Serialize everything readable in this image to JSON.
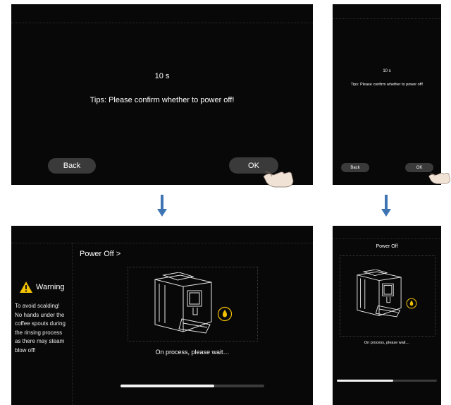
{
  "confirm_dialog": {
    "countdown": "10 s",
    "tip": "Tips: Please confirm whether to power off!",
    "back_label": "Back",
    "ok_label": "OK"
  },
  "power_off_screen": {
    "breadcrumb": "Power Off >",
    "title": "Power Off",
    "warning_title": "Warning",
    "warning_lines": [
      "To avoid scalding!",
      "No hands under the",
      "coffee spouts during",
      "the rinsing process",
      "as there may steam",
      "blow off!"
    ],
    "status": "On process, please wait…",
    "status_small": "On process, please wait…",
    "progress": 0.65,
    "progress_small": 0.56
  },
  "colors": {
    "screen_bg": "#080808",
    "button_bg": "#3a3a3a",
    "warning": "#f2c200",
    "arrow": "#3f74b3"
  },
  "icons": [
    "warning-icon",
    "water-drop-icon",
    "hand-pointer-icon",
    "arrow-down-icon",
    "coffee-machine-icon"
  ]
}
